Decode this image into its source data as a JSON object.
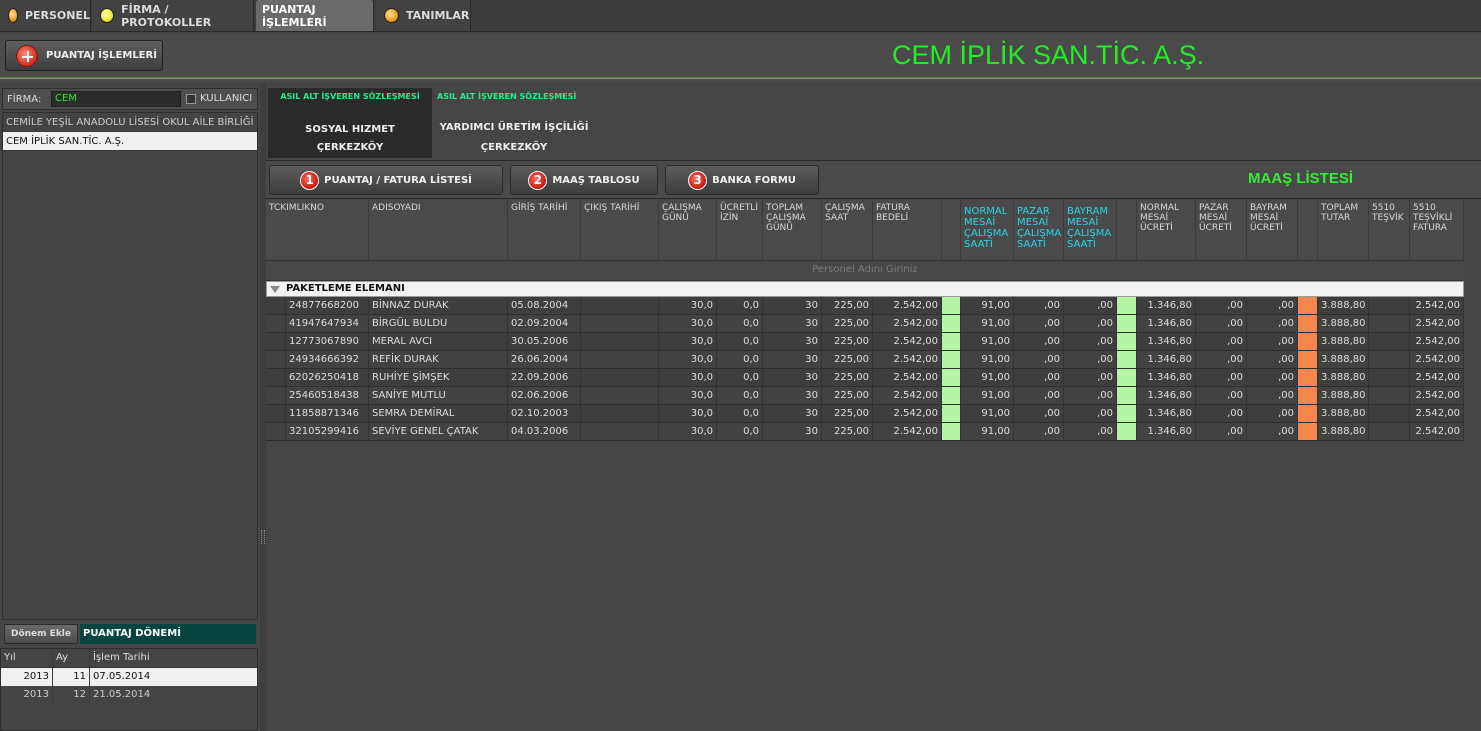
{
  "top_tabs": [
    {
      "label": "PERSONEL",
      "icon": "orange-dot-icon"
    },
    {
      "label": "FİRMA / PROTOKOLLER",
      "icon": "yellow-dot-icon"
    },
    {
      "label": "PUANTAJ İŞLEMLERİ",
      "active": true
    },
    {
      "label": "TANIMLAR",
      "icon": "orange-dot-icon"
    }
  ],
  "toolbar": {
    "puantaj_button": "PUANTAJ İŞLEMLERİ"
  },
  "company_title": "CEM İPLİK SAN.TİC. A.Ş.",
  "left": {
    "firma_label": "FİRMA:",
    "firma_value": "CEM",
    "kullanici_label": "KULLANICI",
    "companies": [
      "CEMİLE YEŞİL ANADOLU LİSESİ OKUL AİLE BİRLİĞİ BAŞKANLIĞI",
      "CEM İPLİK SAN.TİC. A.Ş."
    ],
    "donem_button": "Dönem Ekle",
    "donem_title": "PUANTAJ DÖNEMİ",
    "donem_headers": [
      "Yıl",
      "Ay",
      "İşlem Tarihi"
    ],
    "donem_rows": [
      [
        "2013",
        "11",
        "07.05.2014"
      ],
      [
        "2013",
        "12",
        "21.05.2014"
      ]
    ]
  },
  "contract_tabs": [
    {
      "head": "ASIL ALT İŞVEREN SÖZLEŞMESİ",
      "line1": "SOSYAL HIZMET",
      "line2": "ÇERKEZKÖY"
    },
    {
      "head": "ASIL ALT İŞVEREN SÖZLEŞMESİ",
      "line1": "YARDIMCI ÜRETİM İŞÇİLİĞİ",
      "line2": "ÇERKEZKÖY"
    }
  ],
  "actions": [
    {
      "num": "1",
      "label": "PUANTAJ / FATURA LİSTESİ"
    },
    {
      "num": "2",
      "label": "MAAŞ TABLOSU"
    },
    {
      "num": "3",
      "label": "BANKA FORMU"
    }
  ],
  "list_title": "MAAŞ LİSTESİ",
  "grid": {
    "headers": [
      "TCKIMLIKNO",
      "ADISOYADI",
      "GİRİŞ TARİHİ",
      "ÇIKIŞ TARİHİ",
      "ÇALIŞMA\nGÜNÜ",
      "ÜCRETLİ\nİZİN",
      "TOPLAM\nÇALIŞMA\nGÜNÜ",
      "ÇALIŞMA\nSAAT",
      "FATURA\nBEDELİ",
      "",
      "NORMAL\nMESAİ\nÇALIŞMA\nSAATİ",
      "PAZAR\nMESAİ\nÇALIŞMA\nSAATİ",
      "BAYRAM\nMESAİ\nÇALIŞMA\nSAATİ",
      "",
      "NORMAL\nMESAİ\nÜCRETİ",
      "PAZAR\nMESAİ\nÜCRETİ",
      "BAYRAM\nMESAİ\nÜCRETİ",
      "",
      "TOPLAM\nTUTAR",
      "5510\nTEŞVİK",
      "5510\nTEŞVİKLİ\nFATURA"
    ],
    "filter_placeholder": "Personel Adını Giriniz",
    "group": "PAKETLEME ELEMANI",
    "rows": [
      [
        "24877668200",
        "BİNNAZ DURAK",
        "05.08.2004",
        "",
        "30,0",
        "0,0",
        "30",
        "225,00",
        "2.542,00",
        "",
        "91,00",
        ",00",
        ",00",
        "",
        "1.346,80",
        ",00",
        ",00",
        "",
        "3.888,80",
        "",
        "2.542,00"
      ],
      [
        "41947647934",
        "BİRGÜL BULDU",
        "02.09.2004",
        "",
        "30,0",
        "0,0",
        "30",
        "225,00",
        "2.542,00",
        "",
        "91,00",
        ",00",
        ",00",
        "",
        "1.346,80",
        ",00",
        ",00",
        "",
        "3.888,80",
        "",
        "2.542,00"
      ],
      [
        "12773067890",
        "MERAL AVCI",
        "30.05.2006",
        "",
        "30,0",
        "0,0",
        "30",
        "225,00",
        "2.542,00",
        "",
        "91,00",
        ",00",
        ",00",
        "",
        "1.346,80",
        ",00",
        ",00",
        "",
        "3.888,80",
        "",
        "2.542,00"
      ],
      [
        "24934666392",
        "REFİK DURAK",
        "26.06.2004",
        "",
        "30,0",
        "0,0",
        "30",
        "225,00",
        "2.542,00",
        "",
        "91,00",
        ",00",
        ",00",
        "",
        "1.346,80",
        ",00",
        ",00",
        "",
        "3.888,80",
        "",
        "2.542,00"
      ],
      [
        "62026250418",
        "RUHİYE  ŞİMŞEK",
        "22.09.2006",
        "",
        "30,0",
        "0,0",
        "30",
        "225,00",
        "2.542,00",
        "",
        "91,00",
        ",00",
        ",00",
        "",
        "1.346,80",
        ",00",
        ",00",
        "",
        "3.888,80",
        "",
        "2.542,00"
      ],
      [
        "25460518438",
        "SANİYE  MUTLU",
        "02.06.2006",
        "",
        "30,0",
        "0,0",
        "30",
        "225,00",
        "2.542,00",
        "",
        "91,00",
        ",00",
        ",00",
        "",
        "1.346,80",
        ",00",
        ",00",
        "",
        "3.888,80",
        "",
        "2.542,00"
      ],
      [
        "11858871346",
        "SEMRA  DEMİRAL",
        "02.10.2003",
        "",
        "30,0",
        "0,0",
        "30",
        "225,00",
        "2.542,00",
        "",
        "91,00",
        ",00",
        ",00",
        "",
        "1.346,80",
        ",00",
        ",00",
        "",
        "3.888,80",
        "",
        "2.542,00"
      ],
      [
        "32105299416",
        "SEVİYE GENEL ÇATAK",
        "04.03.2006",
        "",
        "30,0",
        "0,0",
        "30",
        "225,00",
        "2.542,00",
        "",
        "91,00",
        ",00",
        ",00",
        "",
        "1.346,80",
        ",00",
        ",00",
        "",
        "3.888,80",
        "",
        "2.542,00"
      ]
    ]
  },
  "colors": {
    "accent_green": "#22ee22",
    "cyan_header": "#2ad6e6",
    "green_cell": "#b5f5a5",
    "orange_cell": "#f3874c",
    "donem_title_bg": "#05453e"
  }
}
